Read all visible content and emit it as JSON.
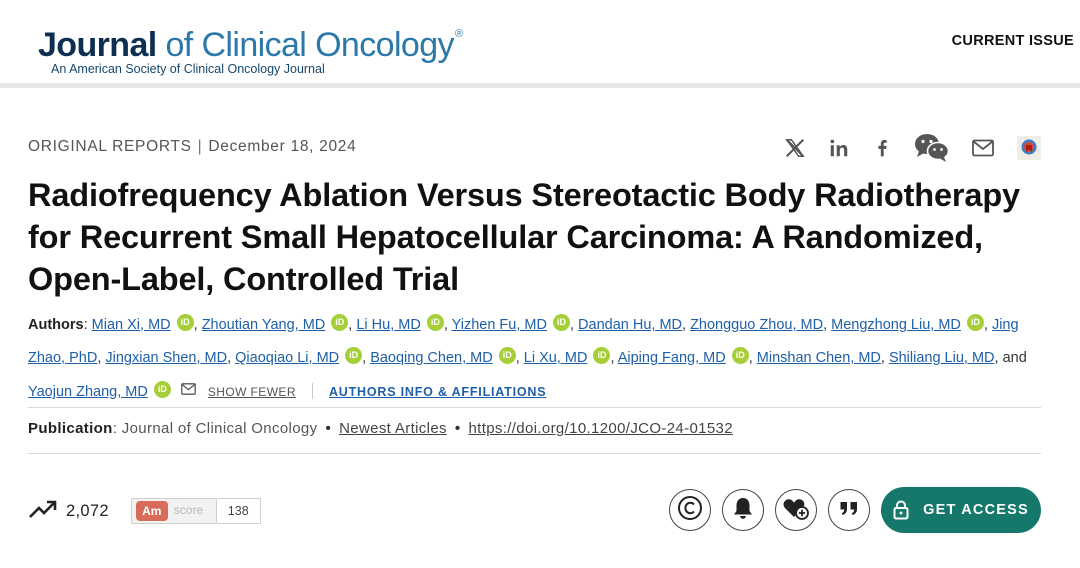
{
  "header": {
    "logo_word1": "Journal",
    "logo_word2": " of Clinical Oncology",
    "logo_reg": "®",
    "logo_subtitle": "An American Society of Clinical Oncology Journal",
    "current_issue": "CURRENT ISSUE"
  },
  "article": {
    "type": "ORIGINAL REPORTS",
    "separator": "|",
    "date": "December 18, 2024",
    "title": "Radiofrequency Ablation Versus Stereotactic Body Radiotherapy for Recurrent Small Hepatocellular Carcinoma: A Randomized, Open-Label, Controlled Trial"
  },
  "share_icons": [
    "x-icon",
    "linkedin-icon",
    "facebook-icon",
    "wechat-icon",
    "email-icon",
    "mendeley-icon"
  ],
  "authors": {
    "label": "Authors",
    "colon": ": ",
    "list": [
      {
        "name": "Mian Xi, MD",
        "orcid": true
      },
      {
        "name": "Zhoutian Yang, MD",
        "orcid": true
      },
      {
        "name": "Li Hu, MD",
        "orcid": true
      },
      {
        "name": "Yizhen Fu, MD",
        "orcid": true
      },
      {
        "name": "Dandan Hu, MD",
        "orcid": false
      },
      {
        "name": "Zhongguo Zhou, MD",
        "orcid": false
      },
      {
        "name": "Mengzhong Liu, MD",
        "orcid": true
      },
      {
        "name": "Jing Zhao, PhD",
        "orcid": false
      },
      {
        "name": "Jingxian Shen, MD",
        "orcid": false
      },
      {
        "name": "Qiaoqiao Li, MD",
        "orcid": true
      },
      {
        "name": "Baoqing Chen, MD",
        "orcid": true
      },
      {
        "name": "Li Xu, MD",
        "orcid": true
      },
      {
        "name": "Aiping Fang, MD",
        "orcid": true
      },
      {
        "name": "Minshan Chen, MD",
        "orcid": false
      },
      {
        "name": "Shiliang Liu, MD",
        "orcid": false
      }
    ],
    "and_word": "and",
    "last_author": {
      "name": "Yaojun Zhang, MD",
      "orcid": true
    },
    "orcid_text": "iD",
    "show_fewer": "SHOW FEWER",
    "affiliations_link": "AUTHORS INFO & AFFILIATIONS"
  },
  "publication": {
    "label": "Publication",
    "colon": ": ",
    "journal": "Journal of Clinical Oncology",
    "bullet": "•",
    "newest_articles": "Newest Articles",
    "doi": "https://doi.org/10.1200/JCO-24-01532"
  },
  "metrics": {
    "views": "2,072",
    "altmetric_logo": "Am",
    "altmetric_label": "score",
    "altmetric_score": "138"
  },
  "actions": {
    "buttons": [
      "copyright-icon",
      "bell-icon",
      "favorite-add-icon",
      "quote-icon"
    ],
    "get_access": "GET ACCESS"
  },
  "colors": {
    "brand_dark": "#0e2f52",
    "brand_light": "#2c78a8",
    "link": "#1f5fa8",
    "orcid": "#a6ce39",
    "access_button": "#16786a"
  }
}
